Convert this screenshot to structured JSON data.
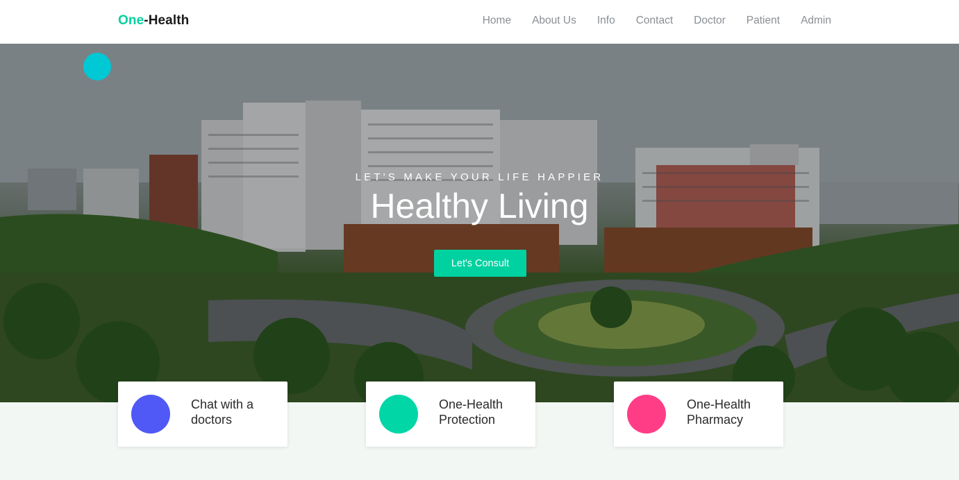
{
  "brand": {
    "part1": "One",
    "part2": "-Health"
  },
  "nav": {
    "items": [
      "Home",
      "About Us",
      "Info",
      "Contact",
      "Doctor",
      "Patient",
      "Admin"
    ]
  },
  "hero": {
    "kicker": "LET'S MAKE YOUR LIFE HAPPIER",
    "headline": "Healthy Living",
    "cta": "Let's Consult"
  },
  "features": [
    {
      "line1": "Chat with a",
      "line2": "doctors",
      "color": "#5058f5"
    },
    {
      "line1": "One-Health",
      "line2": "Protection",
      "color": "#00d6a6"
    },
    {
      "line1": "One-Health",
      "line2": "Pharmacy",
      "color": "#ff3d86"
    }
  ],
  "colors": {
    "accent": "#00d1a0",
    "hero_dot": "#00c8d4"
  }
}
